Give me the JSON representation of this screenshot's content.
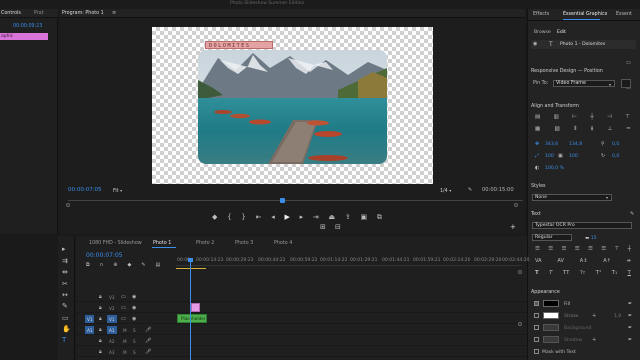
{
  "window": {
    "title": "Photo Slideshow Summer Edition"
  },
  "left_panel": {
    "tabs": [
      "Controls",
      "Prat"
    ],
    "timecode": "00:00:09:23",
    "clip_label": "aphic"
  },
  "program": {
    "tab_label": "Program: Photo 1",
    "title_text": "DOLOMITES",
    "timecode_left": "00:00:07:05",
    "fit_label": "Fit",
    "ratio": "1/4",
    "timecode_right": "00:00:15:00"
  },
  "right_panel": {
    "tabs": [
      "Effects",
      "Essential Graphics",
      "Essent"
    ],
    "subtabs": [
      "Browse",
      "Edit"
    ],
    "layer_name": "Photo 1 - Dolomites",
    "responsive_heading": "Responsive Design — Position",
    "pin_to_label": "Pin To:",
    "pin_to_value": "Video Frame",
    "align_heading": "Align and Transform",
    "pos_x": "343,6",
    "pos_y": "134,8",
    "rotation": "0,0",
    "scale_a": "100",
    "scale_b": "100",
    "opacity_small": "0,0",
    "opacity": "100,0 %",
    "styles_heading": "Styles",
    "style_value": "None",
    "text_heading": "Text",
    "font_value": "Typestar OCR Pro",
    "font_style": "Regular",
    "font_size": "15",
    "appearance_heading": "Appearance",
    "fill_label": "Fill",
    "stroke_label": "Stroke",
    "background_label": "Background",
    "shadow_label": "Shadow",
    "mask_label": "Mask with Text",
    "stroke_value": "1,0",
    "fill_color": "#000000",
    "stroke_color": "#ffffff"
  },
  "timeline": {
    "tabs": [
      "1080 FHD - Slideshow",
      "Photo 1",
      "Photo 2",
      "Photo 3",
      "Photo 4"
    ],
    "timecode": "00:00:07:05",
    "ruler": [
      "00:00",
      "00:00:14:23",
      "00:00:29:23",
      "00:00:44:22",
      "00:00:59:22",
      "00:01:14:22",
      "00:01:29:21",
      "00:01:44:21",
      "00:01:59:21",
      "00:02:14:20",
      "00:02:29:20",
      "00:02:44:20"
    ],
    "tracks": [
      "V3",
      "V2",
      "V1",
      "A1",
      "A2",
      "A3"
    ],
    "clip_name": "Placeholder",
    "accent": "#3b8eea",
    "clip_green": "#4cae4c",
    "clip_pink": "#e79be5"
  }
}
